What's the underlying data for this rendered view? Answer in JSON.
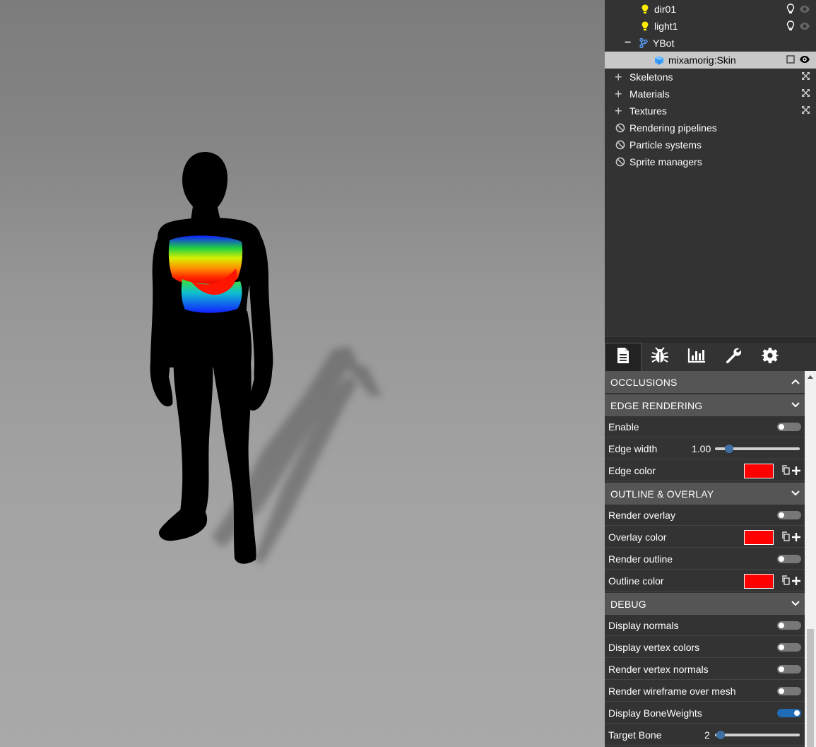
{
  "colors": {
    "panel_bg": "#333333",
    "section_bg": "#555555",
    "selected_row": "#c8c8c8",
    "light_icon": "#ffee00",
    "mesh_icon": "#3aa0ff",
    "toggle_on": "#1f6bb5",
    "swatch_red": "#ff0000"
  },
  "scene_tree": {
    "items": [
      {
        "label": "dir01",
        "icon": "lightbulb-icon"
      },
      {
        "label": "light1",
        "icon": "lightbulb-icon"
      },
      {
        "label": "YBot",
        "icon": "skeleton-branch-icon",
        "expander": "−"
      },
      {
        "label": "mixamorig:Skin",
        "icon": "mesh-cube-icon",
        "selected": true
      },
      {
        "label": "Skeletons",
        "expander": "+"
      },
      {
        "label": "Materials",
        "expander": "+"
      },
      {
        "label": "Textures",
        "expander": "+"
      },
      {
        "label": "Rendering pipelines",
        "icon": "disabled-icon"
      },
      {
        "label": "Particle systems",
        "icon": "disabled-icon"
      },
      {
        "label": "Sprite managers",
        "icon": "disabled-icon"
      }
    ]
  },
  "tabs": [
    {
      "name": "properties",
      "icon": "document-icon",
      "active": true
    },
    {
      "name": "debug",
      "icon": "bug-icon"
    },
    {
      "name": "statistics",
      "icon": "chart-icon"
    },
    {
      "name": "tools",
      "icon": "wrench-icon"
    },
    {
      "name": "settings",
      "icon": "gear-icon"
    }
  ],
  "sections": {
    "occlusions": {
      "title": "OCCLUSIONS",
      "expanded": false
    },
    "edge_rendering": {
      "title": "EDGE RENDERING",
      "enable": {
        "label": "Enable",
        "on": false
      },
      "edge_width": {
        "label": "Edge width",
        "value": "1.00",
        "level": 0.13
      },
      "edge_color": {
        "label": "Edge color",
        "color": "#ff0000"
      }
    },
    "outline_overlay": {
      "title": "OUTLINE & OVERLAY",
      "render_overlay": {
        "label": "Render overlay",
        "on": false
      },
      "overlay_color": {
        "label": "Overlay color",
        "color": "#ff0000"
      },
      "render_outline": {
        "label": "Render outline",
        "on": false
      },
      "outline_color": {
        "label": "Outline color",
        "color": "#ff0000"
      }
    },
    "debug": {
      "title": "DEBUG",
      "display_normals": {
        "label": "Display normals",
        "on": false
      },
      "display_vertex_colors": {
        "label": "Display vertex colors",
        "on": false
      },
      "render_vertex_normals": {
        "label": "Render vertex normals",
        "on": false
      },
      "render_wireframe": {
        "label": "Render wireframe over mesh",
        "on": false
      },
      "display_bone_weights": {
        "label": "Display BoneWeights",
        "on": true
      },
      "target_bone": {
        "label": "Target Bone",
        "value": "2",
        "level": 0.02
      }
    }
  }
}
